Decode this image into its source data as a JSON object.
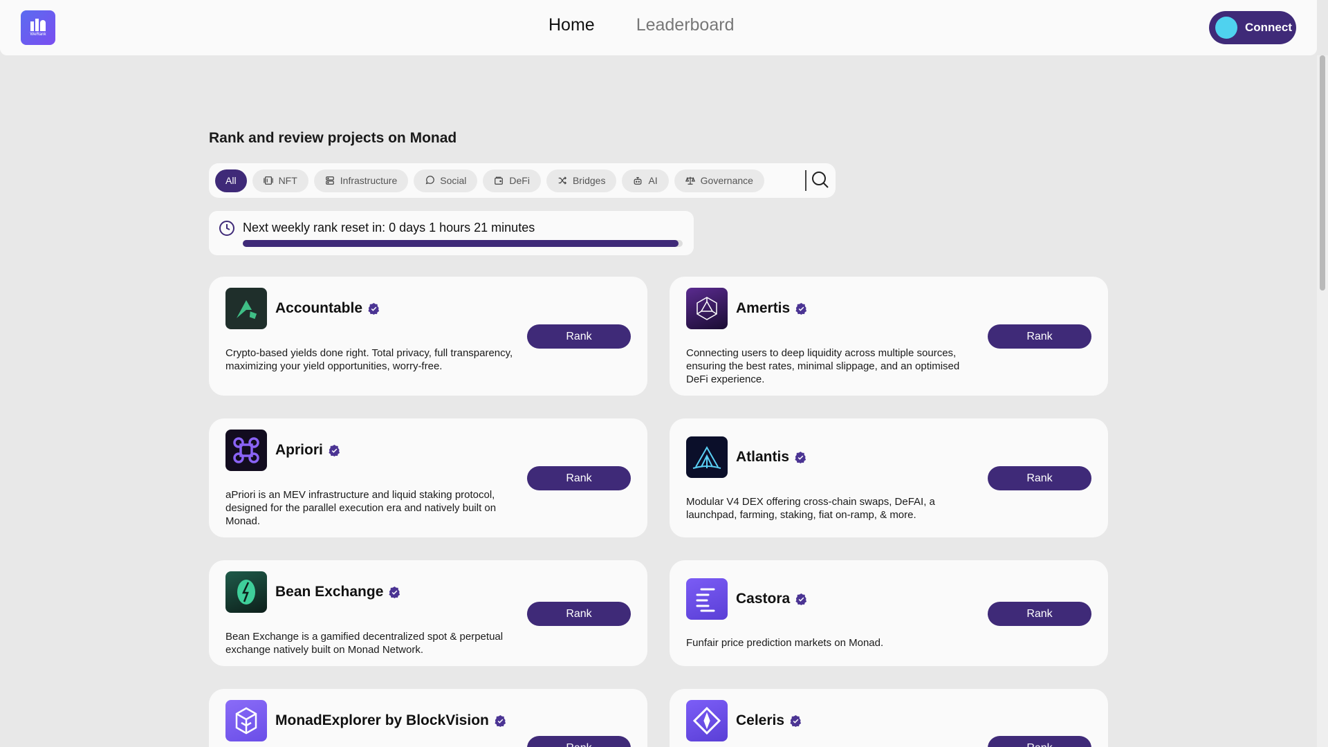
{
  "header": {
    "logo_text": "WeRank",
    "nav": [
      {
        "label": "Home",
        "active": true
      },
      {
        "label": "Leaderboard",
        "active": false
      }
    ],
    "connect_label": "Connect"
  },
  "main": {
    "heading": "Rank and review projects on Monad",
    "filters": [
      {
        "label": "All",
        "icon": "none",
        "active": true
      },
      {
        "label": "NFT",
        "icon": "nft-icon",
        "active": false
      },
      {
        "label": "Infrastructure",
        "icon": "server-icon",
        "active": false
      },
      {
        "label": "Social",
        "icon": "chat-icon",
        "active": false
      },
      {
        "label": "DeFi",
        "icon": "wallet-icon",
        "active": false
      },
      {
        "label": "Bridges",
        "icon": "shuffle-icon",
        "active": false
      },
      {
        "label": "AI",
        "icon": "bot-icon",
        "active": false
      },
      {
        "label": "Governance",
        "icon": "scale-icon",
        "active": false
      }
    ],
    "timer": {
      "text": "Next weekly rank reset in: 0 days 1 hours 21 minutes",
      "progress": 0.99
    },
    "rank_label": "Rank",
    "projects": [
      {
        "name": "Accountable",
        "description": "Crypto-based yields done right. Total privacy, full transparency, maximizing your yield opportunities, worry-free.",
        "icon": "accountable-logo"
      },
      {
        "name": "Amertis",
        "description": "Connecting users to deep liquidity across multiple sources, ensuring the best rates, minimal slippage, and an optimised DeFi experience.",
        "icon": "amertis-logo"
      },
      {
        "name": "Apriori",
        "description": "aPriori is an MEV infrastructure and liquid staking protocol, designed for the parallel execution era and natively built on Monad.",
        "icon": "apriori-logo"
      },
      {
        "name": "Atlantis",
        "description": "Modular V4 DEX offering cross-chain swaps, DeFAI, a launchpad, farming, staking, fiat on-ramp, & more.",
        "icon": "atlantis-logo"
      },
      {
        "name": "Bean Exchange",
        "description": "Bean Exchange is a gamified decentralized spot & perpetual exchange natively built on Monad Network.",
        "icon": "bean-exchange-logo"
      },
      {
        "name": "Castora",
        "description": "Funfair price prediction markets on Monad.",
        "icon": "castora-logo"
      },
      {
        "name": "MonadExplorer by BlockVision",
        "description": "",
        "icon": "monadexplorer-logo"
      },
      {
        "name": "Celeris",
        "description": "",
        "icon": "celeris-logo"
      }
    ]
  },
  "colors": {
    "accent": "#3f2a78",
    "background": "#e8e8e8",
    "card": "#fafafa",
    "connect_dot": "#4fd2ef"
  }
}
